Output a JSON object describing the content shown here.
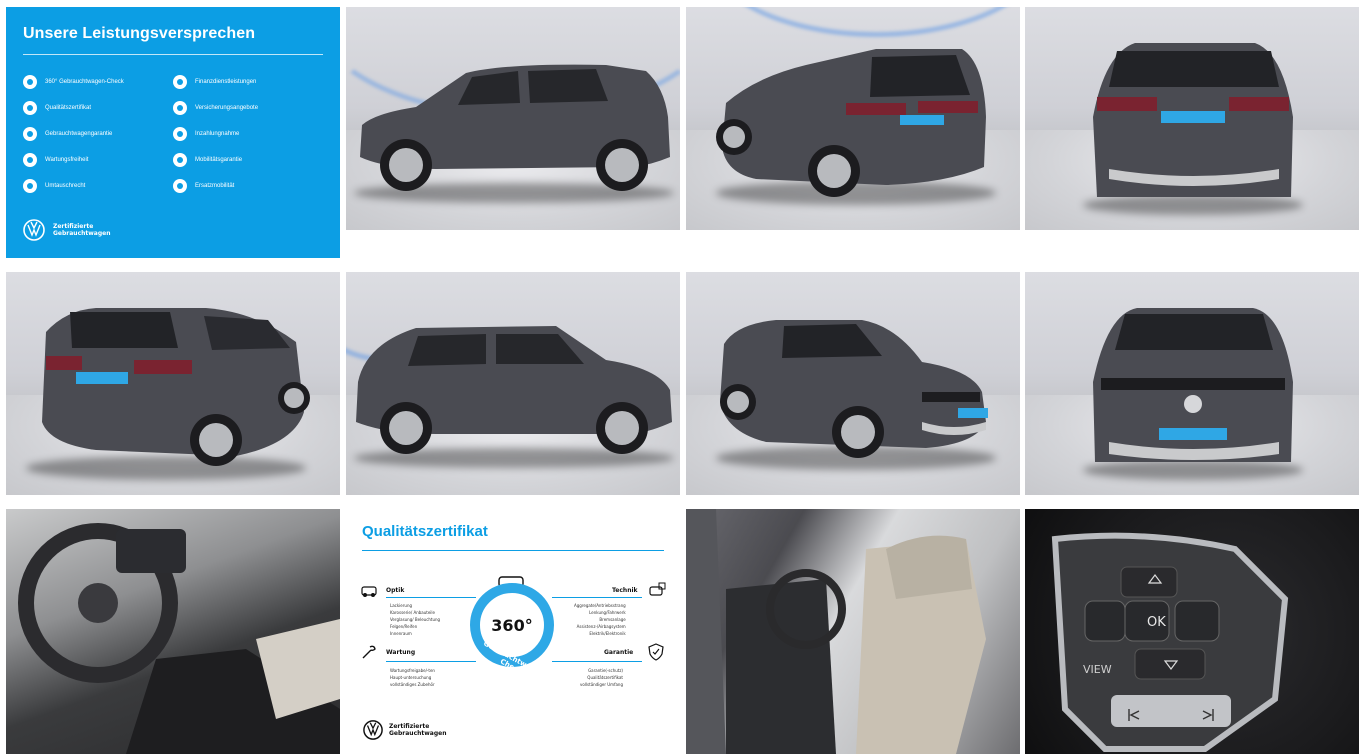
{
  "promise": {
    "title": "Unsere Leistungsversprechen",
    "left_items": [
      "360° Gebrauchtwagen-Check",
      "Qualitätszertifikat",
      "Gebrauchtwagengarantie",
      "Wartungsfreiheit",
      "Umtauschrecht"
    ],
    "right_items": [
      "Finanzdienstleistungen",
      "Versicherungsangebote",
      "Inzahlungnahme",
      "Mobilitätsgarantie",
      "Ersatzmobilität"
    ],
    "logo_line1": "Zertifizierte",
    "logo_line2": "Gebrauchtwagen"
  },
  "quali": {
    "title": "Qualitätszertifikat",
    "optik": "Optik",
    "optik_items": [
      "Lackierung",
      "Karosserie/ Anbauteile",
      "Verglasung/ Beleuchtung",
      "Felgen/Reifen",
      "Innenraum"
    ],
    "wartung": "Wartung",
    "wartung_items": [
      "Wartungsfreigabe/-ten",
      "Haupt-untersuchung",
      "vollständiges Zubehör"
    ],
    "technik": "Technik",
    "technik_items": [
      "Aggregate/Antriebsstrang",
      "Lenkung/Fahrwerk",
      "Bremsanlage",
      "Assistenz-/Airbagsystem",
      "Elektrik/Elektronik"
    ],
    "garantie": "Garantie",
    "garantie_items": [
      "Garantie(-schutz)",
      "Qualitätszertifikat",
      "vollständiger Umfang"
    ],
    "badge_number": "360°",
    "badge_ring": "Gebrauchtwagen-Check",
    "logo_line1": "Zertifizierte",
    "logo_line2": "Gebrauchtwagen"
  },
  "wheel_buttons": {
    "ok": "OK",
    "view": "VIEW"
  },
  "colors": {
    "vw_blue": "#0c9ee4",
    "car_grey": "#4a4b52",
    "studio": "#d3d4d8"
  }
}
